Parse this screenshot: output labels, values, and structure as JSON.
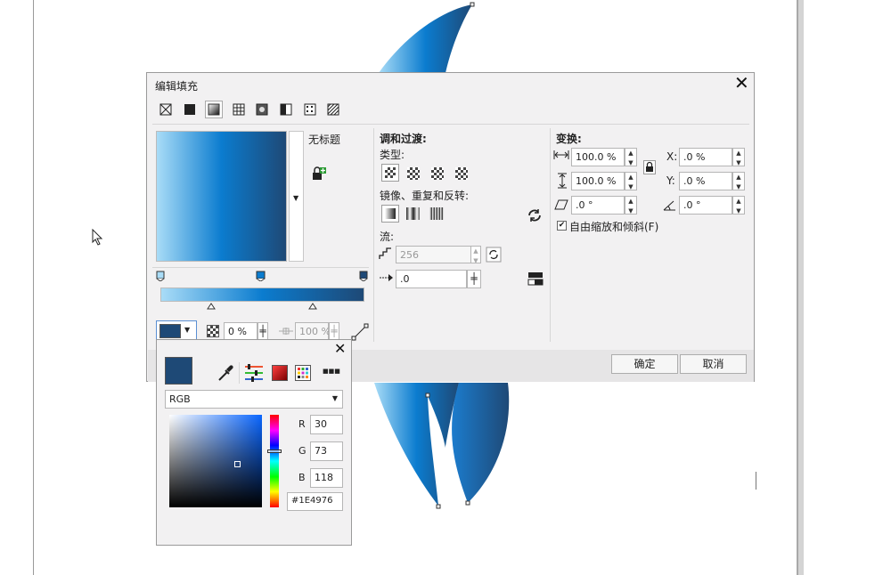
{
  "dialog": {
    "title": "编辑填充",
    "close_label": "✕",
    "preset_name": "无标题",
    "ok_label": "确定",
    "cancel_label": "取消"
  },
  "blend": {
    "section_title": "调和过渡:",
    "type_label": "类型:",
    "mirror_label": "镜像、重复和反转:",
    "flow_label": "流:",
    "steps_value": "256",
    "accel_value": ".0"
  },
  "transform": {
    "section_title": "变换:",
    "width_value": "100.0 %",
    "height_value": "100.0 %",
    "skew_value": ".0 °",
    "x_label": "X:",
    "x_value": ".0 %",
    "y_label": "Y:",
    "y_value": ".0 %",
    "rotate_value": ".0 °",
    "free_scale_label": "自由缩放和倾斜(F)",
    "free_scale_checked": true
  },
  "gradient_bar": {
    "transparency_value": "0 %",
    "position_value": "100 %",
    "stops": [
      "#a9dcf7",
      "#0b7ccf",
      "#1e4976"
    ]
  },
  "color_popup": {
    "close_label": "✕",
    "model": "RGB",
    "r_label": "R",
    "r_value": "30",
    "g_label": "G",
    "g_value": "73",
    "b_label": "B",
    "b_value": "118",
    "hex_value": "#1E4976",
    "current_color": "#1e4976",
    "more_label": "■■■"
  },
  "colors": {
    "accent": "#1e4976",
    "gradient_start": "#a9dcf7",
    "gradient_mid": "#0b7ccf",
    "gradient_end": "#1e4976"
  }
}
